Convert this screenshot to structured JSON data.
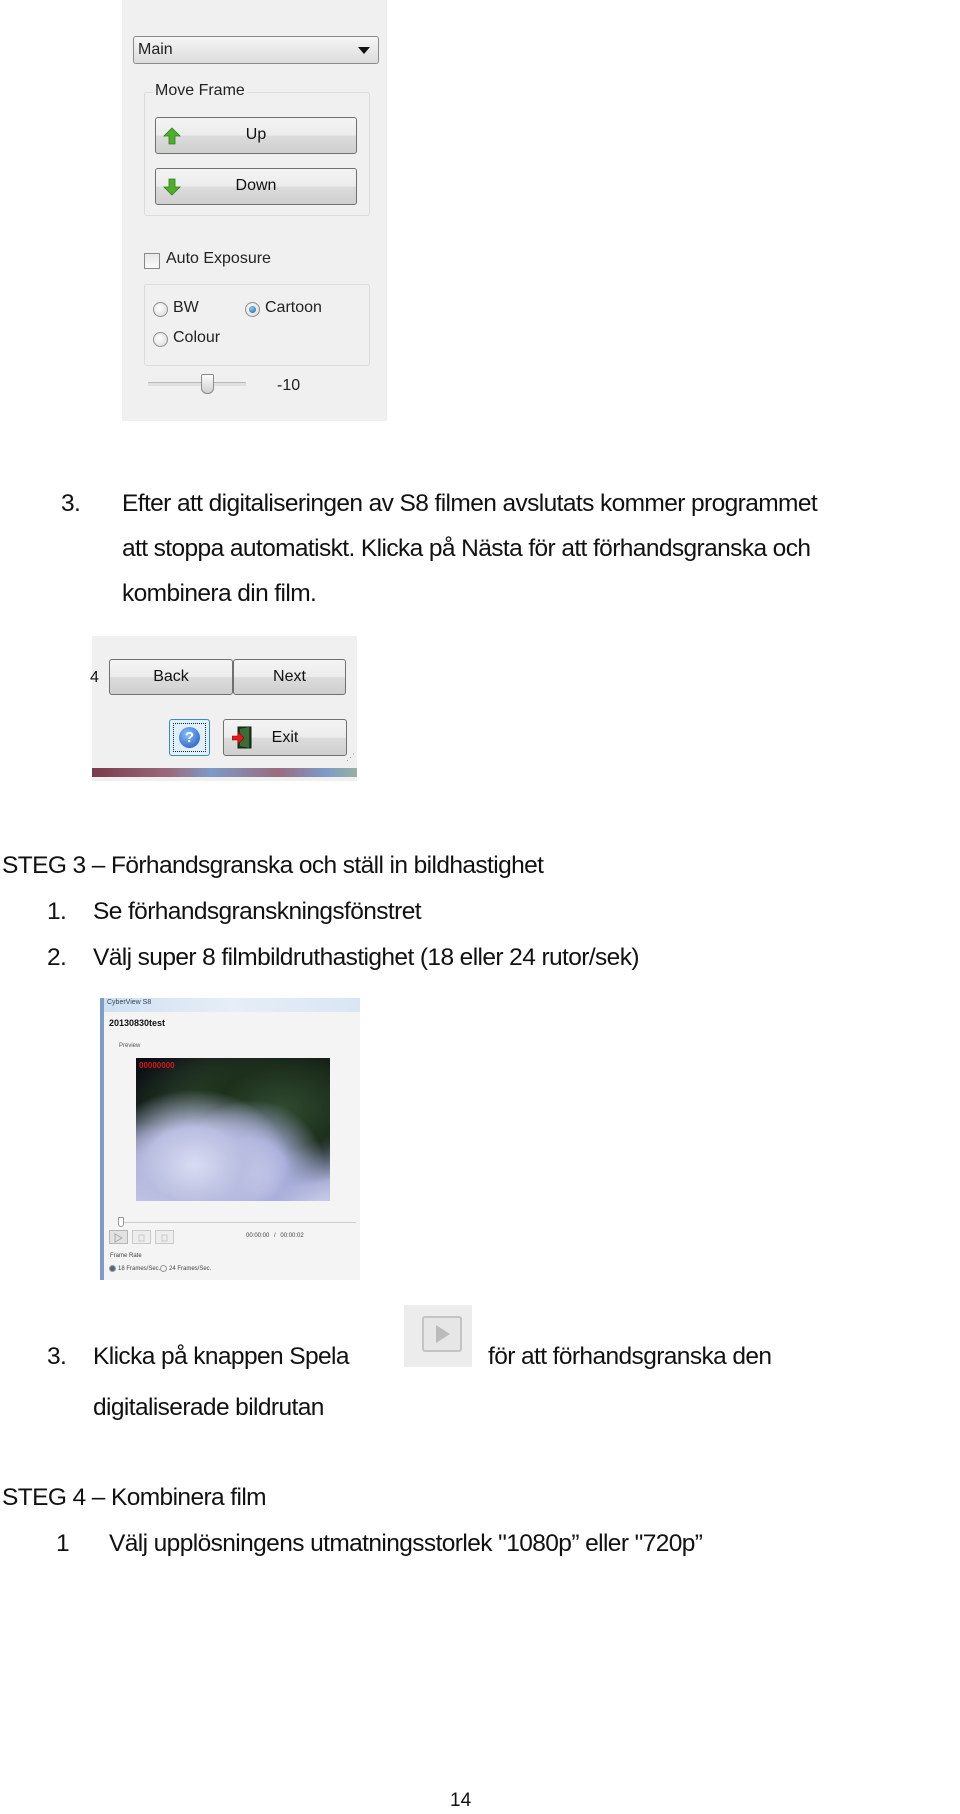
{
  "panel_settings": {
    "dropdown_value": "Main",
    "move_frame_group": "Move Frame",
    "up_button": "Up",
    "down_button": "Down",
    "auto_exposure_label": "Auto Exposure",
    "auto_exposure_checked": false,
    "mode_options": [
      {
        "label": "BW",
        "selected": false
      },
      {
        "label": "Cartoon",
        "selected": true
      },
      {
        "label": "Colour",
        "selected": false
      }
    ],
    "slider_value": "-10"
  },
  "step3_item": {
    "number": "3.",
    "lines": [
      "Efter att digitaliseringen av S8 filmen avslutats kommer programmet",
      "att stoppa automatiskt. Klicka på Nästa för att förhandsgranska och",
      "kombinera din film."
    ]
  },
  "panel_nav": {
    "edge_char": "4",
    "back_button": "Back",
    "next_button": "Next",
    "help_symbol": "?",
    "exit_button": "Exit",
    "grip": "⋰"
  },
  "steg3": {
    "heading": "STEG 3 – Förhandsgranska och ställ in bildhastighet",
    "items": [
      {
        "number": "1.",
        "text": "Se förhandsgranskningsfönstret"
      },
      {
        "number": "2.",
        "text": "Välj super 8 filmbildruthastighet (18 eller 24 rutor/sek)"
      }
    ]
  },
  "preview_window": {
    "app_title": "CyberView S8",
    "project_name": "20130830test",
    "preview_label": "Preview",
    "frame_counter": "00000000",
    "time_current": "00:00:00",
    "time_separator": "/",
    "time_total": "00:00:02",
    "frame_rate_label": "Frame Rate",
    "frame_rate_options": [
      {
        "label": "18 Frames/Sec.",
        "selected": true
      },
      {
        "label": "24 Frames/Sec.",
        "selected": false
      }
    ]
  },
  "step3_play": {
    "number": "3.",
    "before_icon": "Klicka på knappen Spela",
    "after_icon": "för att förhandsgranska den",
    "line2": "digitaliserade bildrutan"
  },
  "steg4": {
    "heading": "STEG 4 – Kombinera film",
    "items": [
      {
        "number": "1",
        "text": "Välj upplösningens utmatningsstorlek \"1080p” eller \"720p”"
      }
    ]
  },
  "page_number": "14"
}
